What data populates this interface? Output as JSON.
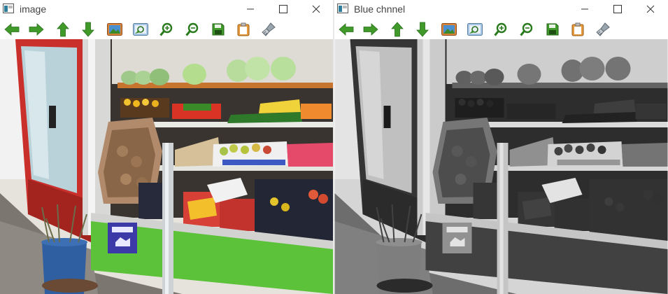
{
  "windows": [
    {
      "title": "image",
      "buttons": {
        "minimize": "minimize-icon",
        "maximize": "maximize-icon",
        "close": "close-icon"
      },
      "toolbar": [
        "arrow-left-icon",
        "arrow-right-icon",
        "arrow-up-icon",
        "arrow-down-icon",
        "image-icon",
        "zoom-to-fit-icon",
        "zoom-in-icon",
        "zoom-out-icon",
        "save-icon",
        "copy-to-clipboard-icon",
        "properties-icon"
      ],
      "canvas": {
        "content": "photo of a fruit and vegetable market stall, original color"
      }
    },
    {
      "title": "Blue chnnel",
      "buttons": {
        "minimize": "minimize-icon",
        "maximize": "maximize-icon",
        "close": "close-icon"
      },
      "toolbar": [
        "arrow-left-icon",
        "arrow-right-icon",
        "arrow-up-icon",
        "arrow-down-icon",
        "image-icon",
        "zoom-to-fit-icon",
        "zoom-in-icon",
        "zoom-out-icon",
        "save-icon",
        "copy-to-clipboard-icon",
        "properties-icon"
      ],
      "canvas": {
        "content": "same photo rendered as the blue channel in grayscale"
      }
    }
  ],
  "colors": {
    "arrow_green": "#3f9a2a",
    "stall_red": "#c9302c",
    "stall_green": "#5cc23a",
    "sign_blue": "#3c3aa6"
  }
}
